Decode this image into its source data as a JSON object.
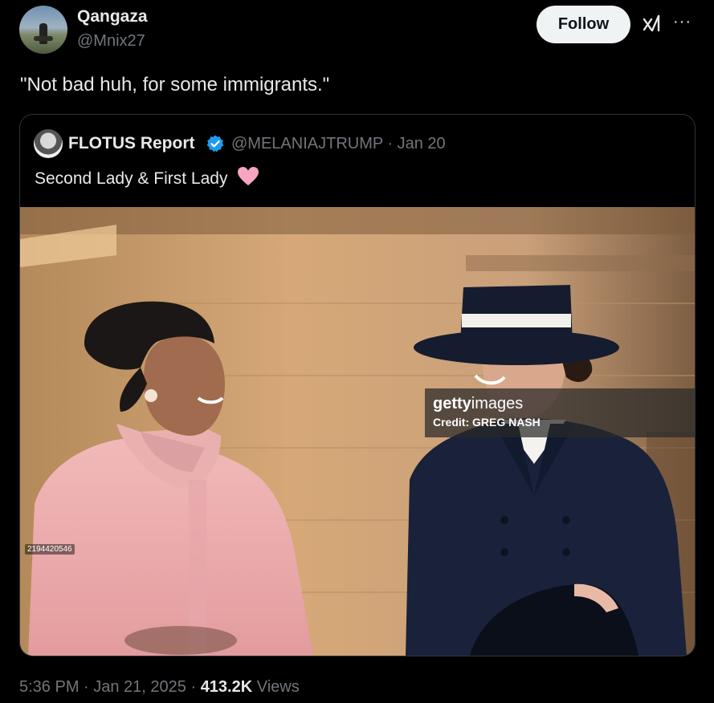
{
  "author": {
    "name": "Qangaza",
    "handle": "@Mnix27"
  },
  "actions": {
    "follow_label": "Follow",
    "grok_icon": "grok-icon",
    "more_icon": "more-icon",
    "more_label": "···"
  },
  "tweet": {
    "text": "\"Not bad huh, for some immigrants.\""
  },
  "quoted": {
    "name": "FLOTUS Report",
    "handle_date": "@MELANIAJTRUMP · Jan 20",
    "text": "Second Lady & First Lady",
    "verified_color": "#1d9bf0",
    "heart_color": "#f7a6c1",
    "image": {
      "watermark_brand_bold": "getty",
      "watermark_brand": "images",
      "credit": "Credit: GREG NASH",
      "photo_id": "2194420546"
    }
  },
  "meta": {
    "time": "5:36 PM · Jan 21, 2025 · ",
    "views_count": "413.2K",
    "views_label": " Views"
  }
}
